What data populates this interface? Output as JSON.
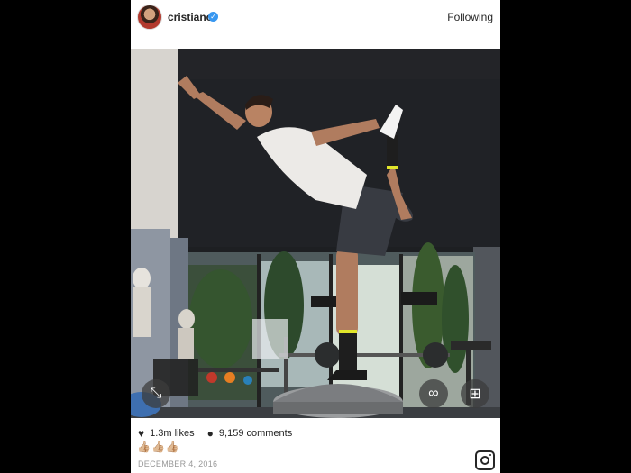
{
  "header": {
    "username": "cristiano",
    "verified_icon": "verified-badge-icon",
    "follow_label": "Following"
  },
  "post": {
    "likes": "1.3m likes",
    "comments": "9,159 comments",
    "caption_emoji": "👍🏼👍🏼👍🏼",
    "date": "DECEMBER 4, 2016"
  },
  "controls": {
    "left_icon": "expand-icon",
    "mid_icon": "boomerang-icon",
    "right_icon": "layout-icon"
  }
}
